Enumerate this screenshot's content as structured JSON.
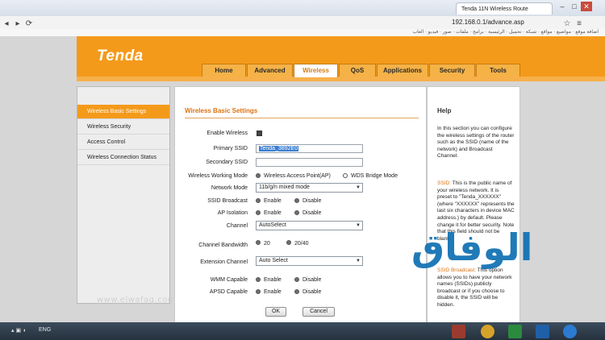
{
  "browser": {
    "tab_title": "Tenda 11N Wireless Route",
    "url": "192.168.0.1/advance.asp",
    "bookmarks_text": "اضافة موقع · مواضيع · مواقع · شبكة · تحميل · الرئيسية · برامج · ملفات · صور · فيديو · العاب"
  },
  "header": {
    "logo": "Tenda",
    "tabs": [
      "Home",
      "Advanced",
      "Wireless",
      "QoS",
      "Applications",
      "Security",
      "Tools"
    ],
    "active_tab": "Wireless"
  },
  "sidebar": {
    "items": [
      "Wireless Basic Settings",
      "Wireless Security",
      "Access Control",
      "Wireless Connection Status"
    ]
  },
  "form": {
    "title": "Wireless Basic Settings",
    "enable_wireless_label": "Enable Wireless",
    "primary_ssid_label": "Primary SSID",
    "primary_ssid_value": "Tenda_3892E0",
    "secondary_ssid_label": "Secondary SSID",
    "secondary_ssid_value": "",
    "working_mode_label": "Wireless Working Mode",
    "working_mode_options": [
      "Wireless Access Point(AP)",
      "WDS Bridge Mode"
    ],
    "network_mode_label": "Network Mode",
    "network_mode_value": "11b/g/n mixed mode",
    "ssid_broadcast_label": "SSID Broadcast",
    "ap_isolation_label": "AP Isolation",
    "enable_label": "Enable",
    "disable_label": "Disable",
    "channel_label": "Channel",
    "channel_value": "AutoSelect",
    "bandwidth_label": "Channel Bandwidth",
    "bandwidth_options": [
      "20",
      "20/40"
    ],
    "extension_channel_label": "Extension Channel",
    "extension_channel_value": "Auto Select",
    "wmm_label": "WMM Capable",
    "apsd_label": "APSD Capable",
    "ok_label": "OK",
    "cancel_label": "Cancel"
  },
  "help": {
    "title": "Help",
    "p1": "In this section you can configure the wireless settings of the router such as the SSID (name of the network) and Broadcast Channel.",
    "p2_key": "SSID:",
    "p2": "This is the public name of your wireless network. It is preset to \"Tenda_XXXXXX\" (where \"XXXXXX\" represents the last six characters in device MAC address.) by default. Please change it for better security. Note that this field should not be blank.",
    "p3_key": "SSID Broadcast:",
    "p3": "This option allows you to have your network names (SSIDs) publicly broadcast or if you choose to disable it, the SSID will be hidden."
  },
  "watermark": {
    "text": "الوفاق",
    "url": "www.elwafaq.com"
  },
  "taskbar": {
    "lang": "ENG",
    "accent": "#f49a1a"
  }
}
